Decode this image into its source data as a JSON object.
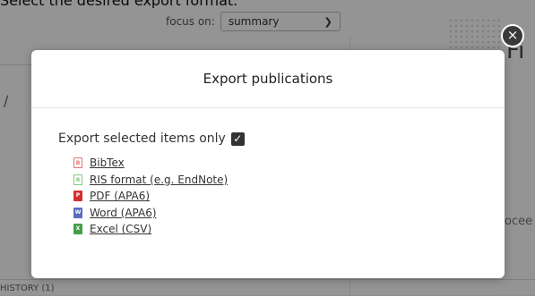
{
  "page": {
    "instruction": "Select the desired export format.",
    "focus_label": "focus on:",
    "focus_value": "summary",
    "right_title_fragment": "Fi",
    "right_text_fragment": "ocee",
    "left_fragment": "/",
    "history_label": "HISTORY (1)"
  },
  "modal": {
    "title": "Export publications",
    "selected_only_label": "Export selected items only",
    "selected_only_checked": true,
    "close_glyph": "×",
    "formats": [
      {
        "label": "BibTex",
        "icon": "bibtex-icon",
        "color": "#e57373"
      },
      {
        "label": "RIS format (e.g. EndNote)",
        "icon": "ris-icon",
        "color": "#81c784"
      },
      {
        "label": "PDF (APA6)",
        "icon": "pdf-icon",
        "color": "#d32f2f"
      },
      {
        "label": "Word (APA6)",
        "icon": "word-icon",
        "color": "#3f51b5"
      },
      {
        "label": "Excel (CSV)",
        "icon": "excel-icon",
        "color": "#43a047"
      }
    ]
  }
}
